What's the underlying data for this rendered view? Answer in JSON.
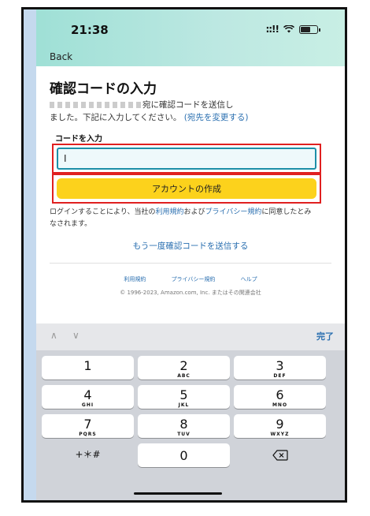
{
  "status": {
    "time": "21:38",
    "signal": "::!!"
  },
  "nav": {
    "back_label": "Back"
  },
  "main": {
    "title": "確認コードの入力",
    "desc_line1_suffix": "宛に確認コードを送信し",
    "desc_line2_prefix": "ました。下記に入力してください。",
    "change_link": "(宛先を変更する)",
    "code_label": "コードを入力",
    "code_value": "I",
    "create_button": "アカウントの作成",
    "legal_prefix": "ログインすることにより、当社の",
    "terms_link": "利用規約",
    "legal_mid": "および",
    "privacy_link": "プライバシー規約",
    "legal_suffix": "に同意したとみなされます。",
    "resend_link": "もう一度確認コードを送信する"
  },
  "footer": {
    "links": [
      "利用規約",
      "プライバシー規約",
      "ヘルプ"
    ],
    "copyright": "© 1996-2023, Amazon.com, Inc. またはその関連会社"
  },
  "keyboard": {
    "up_arrow": "∧",
    "down_arrow": "∨",
    "done_label": "完了",
    "keys": [
      {
        "num": "1",
        "letters": ""
      },
      {
        "num": "2",
        "letters": "ABC"
      },
      {
        "num": "3",
        "letters": "DEF"
      },
      {
        "num": "4",
        "letters": "GHI"
      },
      {
        "num": "5",
        "letters": "JKL"
      },
      {
        "num": "6",
        "letters": "MNO"
      },
      {
        "num": "7",
        "letters": "PQRS"
      },
      {
        "num": "8",
        "letters": "TUV"
      },
      {
        "num": "9",
        "letters": "WXYZ"
      },
      {
        "num": "0",
        "letters": ""
      }
    ],
    "symbols_label": "+＊#"
  },
  "colors": {
    "accent_yellow": "#fcd21c",
    "link_blue": "#2a6fb0",
    "highlight_red": "#e02020"
  }
}
